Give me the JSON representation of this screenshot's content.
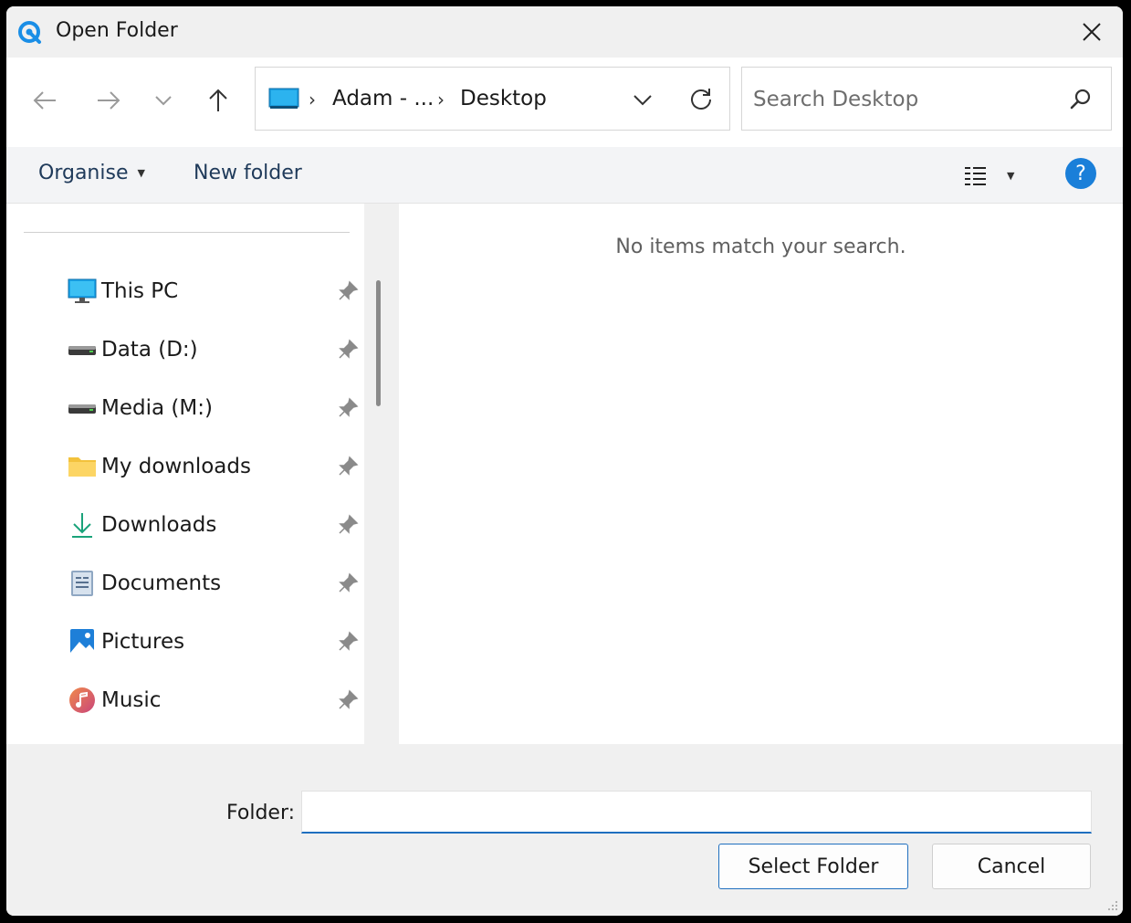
{
  "window": {
    "title": "Open Folder"
  },
  "address": {
    "crumbs": [
      "Adam - ...",
      "Desktop"
    ]
  },
  "search": {
    "placeholder": "Search Desktop"
  },
  "toolbar": {
    "organise_label": "Organise",
    "new_folder_label": "New folder",
    "help_label": "?"
  },
  "nav_pane": {
    "items": [
      {
        "label": "This PC",
        "icon": "monitor-icon"
      },
      {
        "label": "Data (D:)",
        "icon": "drive-icon"
      },
      {
        "label": "Media (M:)",
        "icon": "drive-icon"
      },
      {
        "label": "My downloads",
        "icon": "folder-icon"
      },
      {
        "label": "Downloads",
        "icon": "download-icon"
      },
      {
        "label": "Documents",
        "icon": "document-icon"
      },
      {
        "label": "Pictures",
        "icon": "pictures-icon"
      },
      {
        "label": "Music",
        "icon": "music-icon"
      }
    ]
  },
  "content": {
    "empty_message": "No items match your search."
  },
  "footer": {
    "folder_label": "Folder:",
    "folder_value": "",
    "select_label": "Select Folder",
    "cancel_label": "Cancel"
  },
  "colors": {
    "accent": "#1f6fbf",
    "help": "#1a7fd9"
  }
}
